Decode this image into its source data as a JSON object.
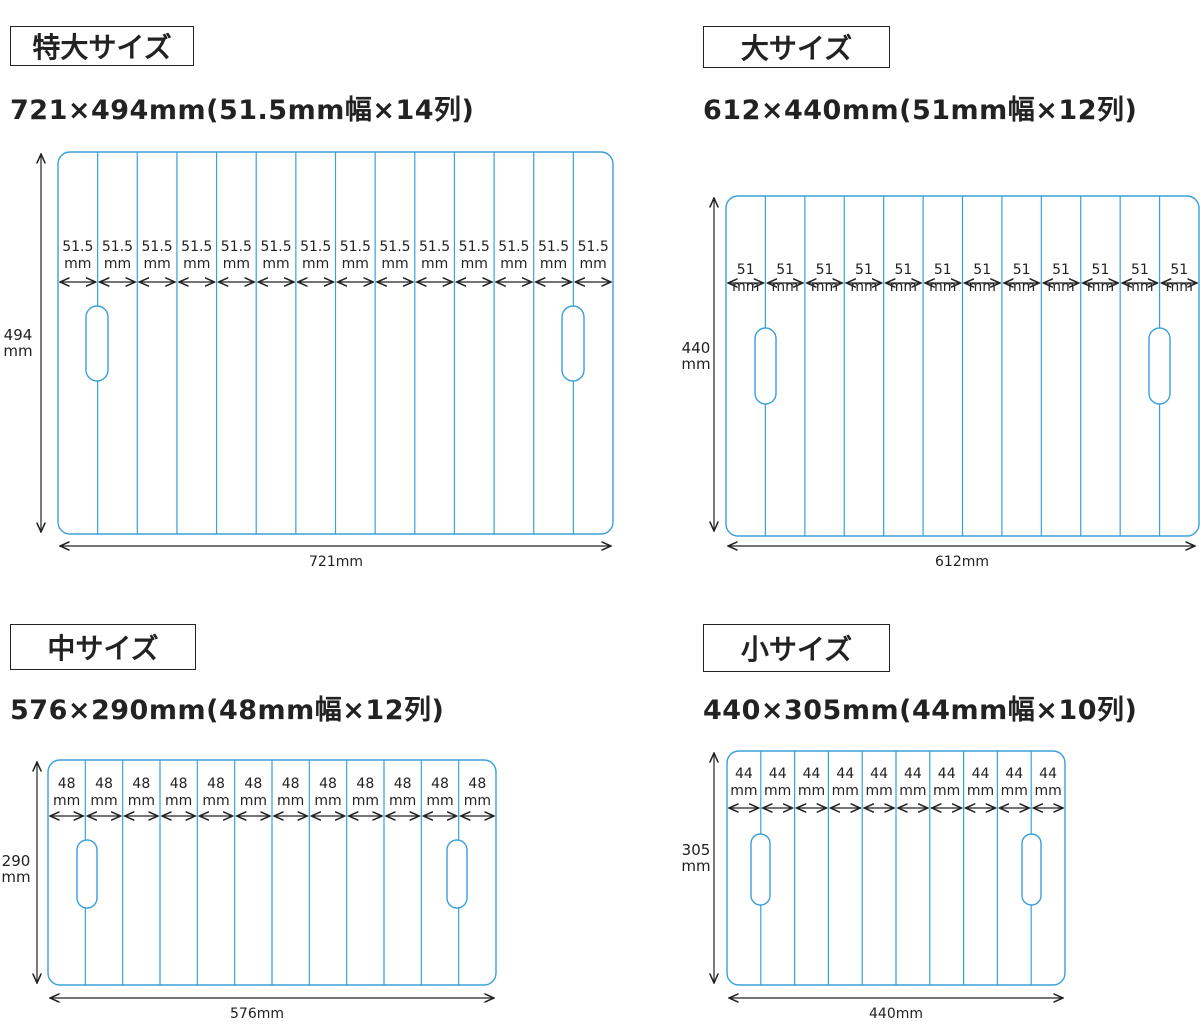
{
  "mats": [
    {
      "id": "xl",
      "label": "特大サイズ",
      "spec": "721×494mm(51.5mm幅×14列)",
      "columns": 14,
      "column_label_top": "51.5",
      "column_label_bottom": "mm",
      "width_label": "721mm",
      "height_label_top": "494",
      "height_label_bottom": "mm"
    },
    {
      "id": "l",
      "label": "大サイズ",
      "spec": "612×440mm(51mm幅×12列)",
      "columns": 12,
      "column_label_top": "51",
      "column_label_bottom": "mm",
      "width_label": "612mm",
      "height_label_top": "440",
      "height_label_bottom": "mm"
    },
    {
      "id": "m",
      "label": "中サイズ",
      "spec": "576×290mm(48mm幅×12列)",
      "columns": 12,
      "column_label_top": "48",
      "column_label_bottom": "mm",
      "width_label": "576mm",
      "height_label_top": "290",
      "height_label_bottom": "mm"
    },
    {
      "id": "s",
      "label": "小サイズ",
      "spec": "440×305mm(44mm幅×10列)",
      "columns": 10,
      "column_label_top": "44",
      "column_label_bottom": "mm",
      "width_label": "440mm",
      "height_label_top": "305",
      "height_label_bottom": "mm"
    }
  ],
  "colors": {
    "mat_outline": "#3aa0d8",
    "dimension_line": "#222222",
    "text": "#222222"
  }
}
